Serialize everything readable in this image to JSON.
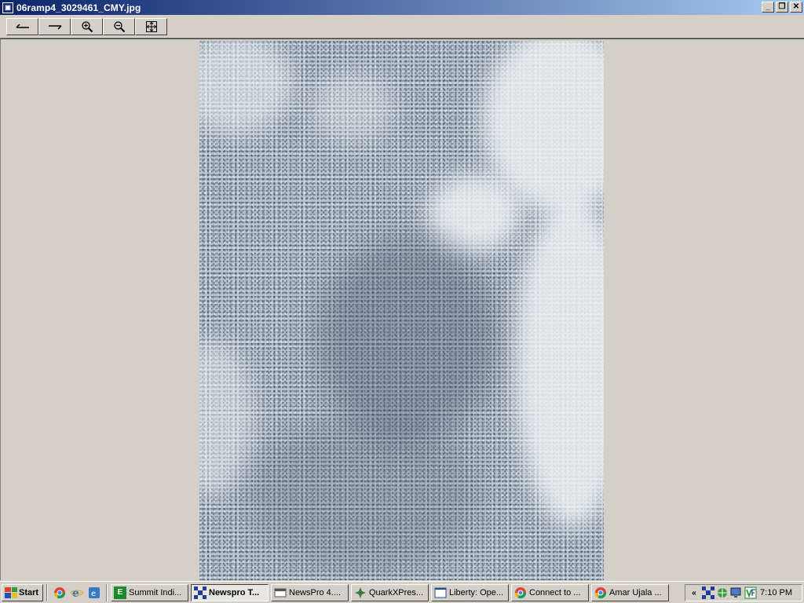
{
  "window": {
    "title": "06ramp4_3029461_CMY.jpg",
    "icon": "image-file-icon",
    "controls": {
      "minimize": "_",
      "restore": "❐",
      "close": "✕"
    }
  },
  "toolbar": {
    "buttons": [
      {
        "name": "previous-button",
        "icon": "arrow-left-icon"
      },
      {
        "name": "next-button",
        "icon": "arrow-right-icon"
      },
      {
        "name": "zoom-in-button",
        "icon": "zoom-in-icon"
      },
      {
        "name": "zoom-out-button",
        "icon": "zoom-out-icon"
      },
      {
        "name": "fit-window-button",
        "icon": "fit-to-window-icon"
      }
    ]
  },
  "taskbar": {
    "start_label": "Start",
    "quick_launch": [
      "chrome-icon",
      "ie-icon",
      "browser-icon"
    ],
    "tasks": [
      {
        "label": "Summit Indi...",
        "icon": "E",
        "color": "#1a8a2a",
        "active": false
      },
      {
        "label": "Newspro T...",
        "icon": "N",
        "color": "#1e3c9e",
        "active": true
      },
      {
        "label": "NewsPro 4....",
        "icon": "▦",
        "color": "#555555",
        "active": false
      },
      {
        "label": "QuarkXPres...",
        "icon": "✦",
        "color": "#3a7a3a",
        "active": false
      },
      {
        "label": "Liberty: Ope...",
        "icon": "▭",
        "color": "#2050a0",
        "active": false
      },
      {
        "label": "Connect to ...",
        "icon": "●",
        "color": "#d04030",
        "active": false
      },
      {
        "label": "Amar Ujala ...",
        "icon": "●",
        "color": "#d04030",
        "active": false
      }
    ],
    "tray": {
      "expand": "«",
      "clock": "7:10 PM"
    }
  }
}
